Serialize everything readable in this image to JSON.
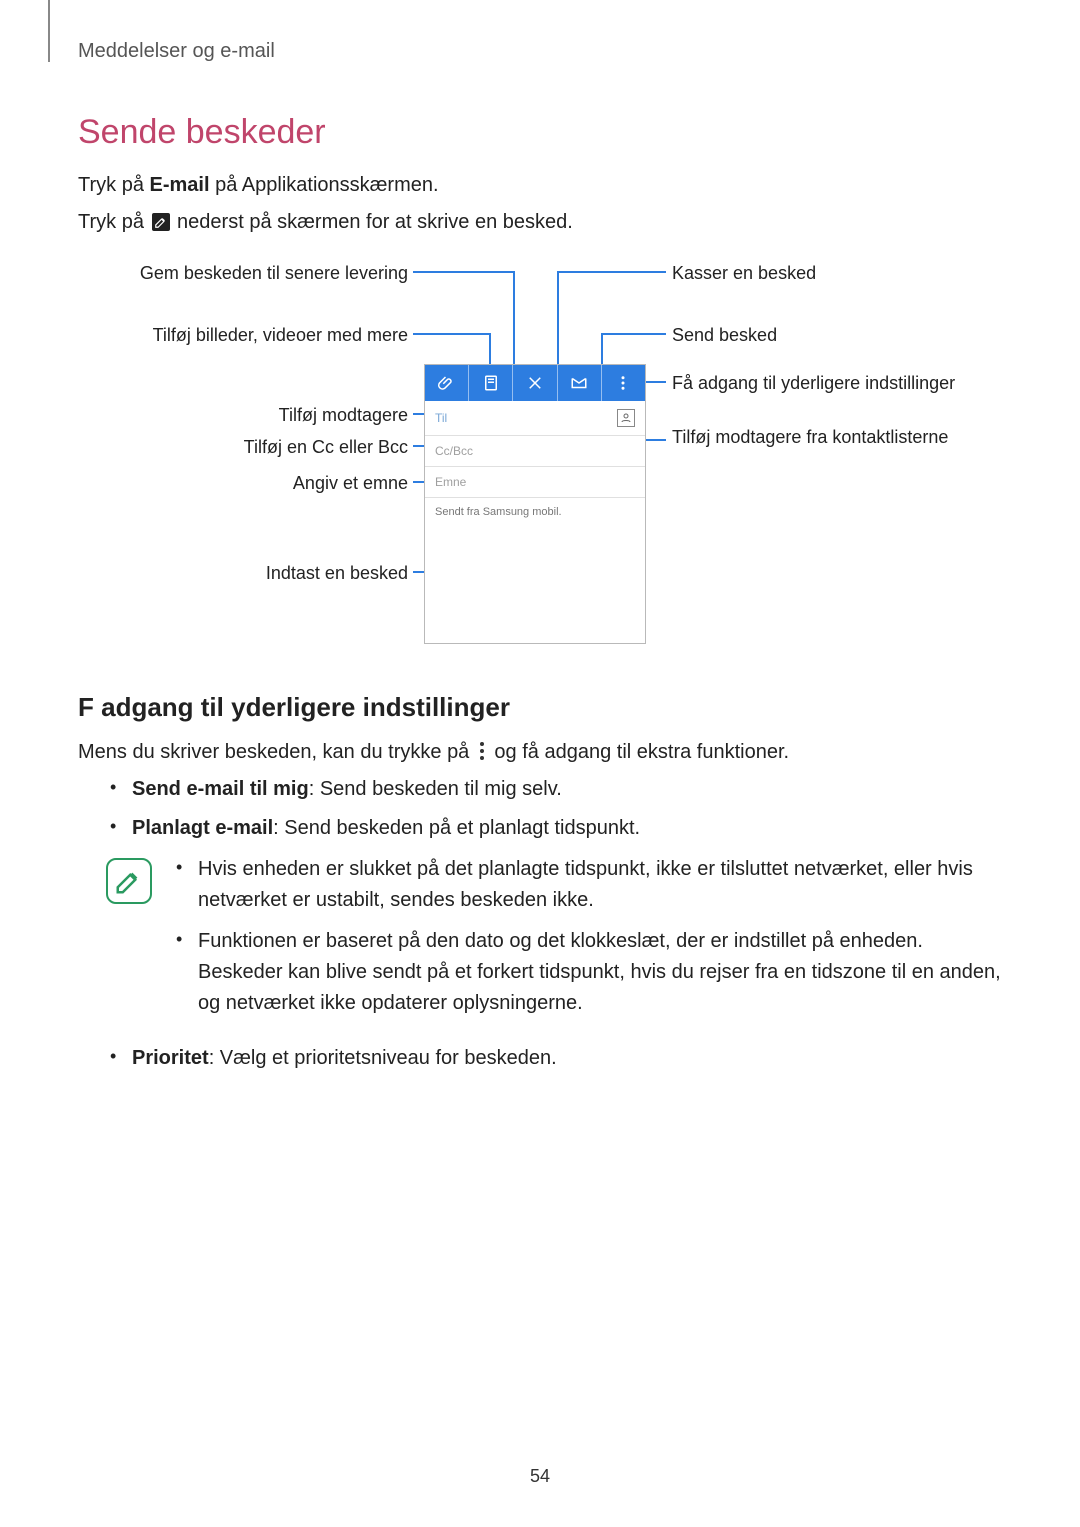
{
  "header": {
    "breadcrumb": "Meddelelser og e-mail"
  },
  "section": {
    "title": "Sende beskeder",
    "intro1_pre": "Tryk på ",
    "intro1_app": "E-mail",
    "intro1_post": " på Applikationsskærmen.",
    "intro2_pre": "Tryk på ",
    "intro2_post": " nederst på skærmen for at skrive en besked."
  },
  "diagram": {
    "left": {
      "save": "Gem beskeden til senere levering",
      "attach": "Tilføj billeder, videoer med mere",
      "recipients": "Tilføj modtagere",
      "ccbcc": "Tilføj en Cc eller Bcc",
      "subject": "Angiv et emne",
      "enter": "Indtast en besked"
    },
    "right": {
      "discard": "Kasser en besked",
      "send": "Send besked",
      "more": "Få adgang til yderligere indstillinger",
      "contacts": "Tilføj modtagere fra kontaktlisterne"
    },
    "phone": {
      "to": "Til",
      "ccbcc": "Cc/Bcc",
      "subject": "Emne",
      "body": "Sendt fra Samsung mobil."
    }
  },
  "more": {
    "title": "F adgang til yderligere indstillinger",
    "intro_pre": "Mens du skriver beskeden, kan du trykke på ",
    "intro_post": " og få adgang til ekstra funktioner.",
    "item1_b": "Send e-mail til mig",
    "item1_t": ": Send beskeden til mig selv.",
    "item2_b": "Planlagt e-mail",
    "item2_t": ": Send beskeden på et planlagt tidspunkt.",
    "note1": "Hvis enheden er slukket på det planlagte tidspunkt, ikke er tilsluttet netværket, eller hvis netværket er ustabilt, sendes beskeden ikke.",
    "note2": "Funktionen er baseret på den dato og det klokkeslæt, der er indstillet på enheden. Beskeder kan blive sendt på et forkert tidspunkt, hvis du rejser fra en tidszone til en anden, og netværket ikke opdaterer oplysningerne.",
    "item3_b": "Prioritet",
    "item3_t": ": Vælg et prioritetsniveau for beskeden."
  },
  "page_number": "54"
}
